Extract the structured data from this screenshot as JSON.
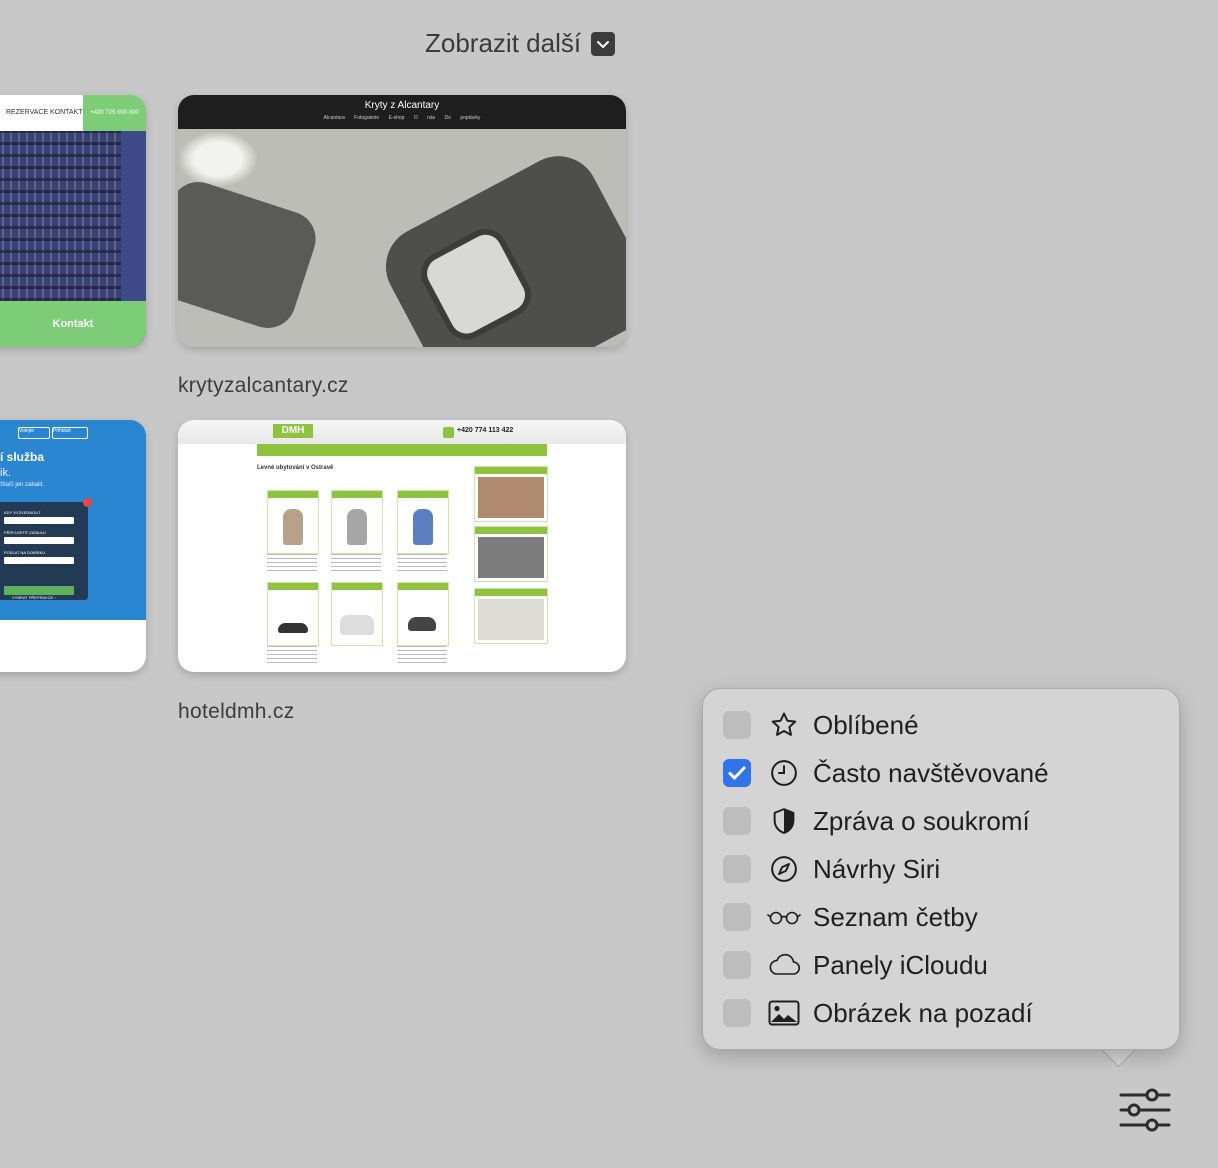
{
  "show_more": {
    "label": "Zobrazit další",
    "icon": "chevron-down-icon"
  },
  "tiles": [
    {
      "id": "hotel-left",
      "nav": [
        "REZERVACE",
        "KONTAKT"
      ],
      "phone": "+420 725 000 000",
      "cta": "Kontakt"
    },
    {
      "id": "krytyzalcantary",
      "header_title": "Kryty z Alcantary",
      "menu": [
        "Alcantara",
        "Fotogalerie",
        "E-shop",
        "O nás",
        "Do poptávky"
      ],
      "label": "krytyzalcantary.cz"
    },
    {
      "id": "service-left",
      "buttons": [
        "Volejte",
        "Přihlásit"
      ],
      "title": "í služba",
      "subtitle": "ik.",
      "note": "Stačí jen zabalit.",
      "form_labels": [
        "KDY VYZVEDNOUT",
        "PŘIPOJISTIT ZÁSILKU",
        "POSLAT NA DOBÍRKU"
      ],
      "form_button": "VYBRAT PŘEPRAVCE ›"
    },
    {
      "id": "hoteldmh",
      "logo": "DMH",
      "phone": "+420 774 113 422",
      "heading": "Levné ubytování v Ostravě",
      "label": "hoteldmh.cz"
    }
  ],
  "popover": {
    "options": [
      {
        "label": "Oblíbené",
        "checked": false,
        "icon": "star-icon"
      },
      {
        "label": "Často navštěvované",
        "checked": true,
        "icon": "clock-icon"
      },
      {
        "label": "Zpráva o soukromí",
        "checked": false,
        "icon": "shield-icon"
      },
      {
        "label": "Návrhy Siri",
        "checked": false,
        "icon": "compass-icon"
      },
      {
        "label": "Seznam četby",
        "checked": false,
        "icon": "glasses-icon"
      },
      {
        "label": "Panely iCloudu",
        "checked": false,
        "icon": "cloud-icon"
      },
      {
        "label": "Obrázek na pozadí",
        "checked": false,
        "icon": "photo-icon"
      }
    ]
  },
  "settings_button": {
    "icon": "sliders-icon"
  },
  "colors": {
    "background": "#c8c8c8",
    "checkbox_on": "#2f74ec",
    "green": "#7ccc78",
    "dmh_green": "#8fc23f"
  }
}
